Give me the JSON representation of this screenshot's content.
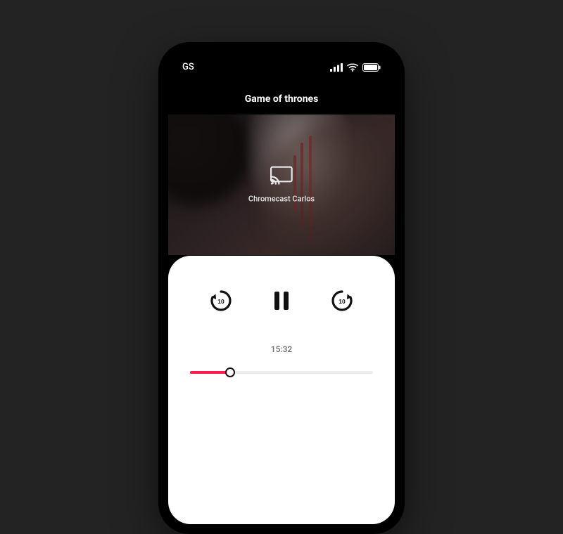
{
  "status": {
    "carrier": "GS"
  },
  "title": "Game of thrones",
  "cast": {
    "device": "Chromecast Carlos"
  },
  "playback": {
    "time_elapsed": "15:32",
    "progress_percent": 22,
    "state": "playing",
    "skip_seconds": 10
  },
  "colors": {
    "accent": "#ff1a52",
    "panel": "#ffffff",
    "bg": "#232323"
  }
}
